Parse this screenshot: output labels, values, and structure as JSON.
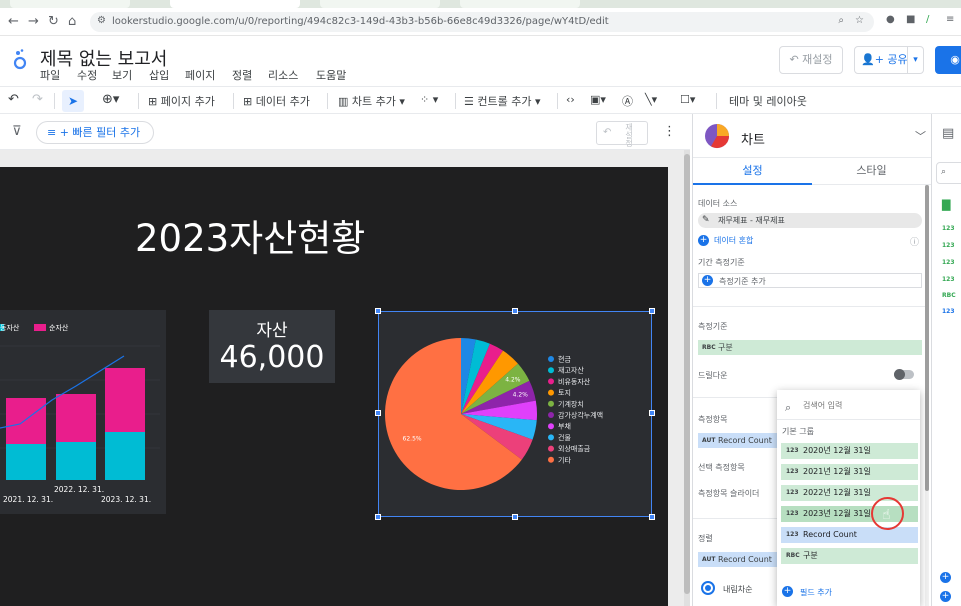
{
  "browser": {
    "url": "lookerstudio.google.com/u/0/reporting/494c82c3-149d-43b3-b56b-66e8c49d3326/page/wY4tD/edit"
  },
  "app": {
    "title": "제목 없는 보고서",
    "menu": [
      "파일",
      "수정",
      "보기",
      "삽입",
      "페이지",
      "정렬",
      "리소스",
      "도움말"
    ],
    "reset_label": "재설정",
    "share_label": "공유"
  },
  "toolbar": {
    "add_page": "페이지 추가",
    "add_data": "데이터 추가",
    "add_chart": "차트 추가",
    "add_control": "컨트롤 추가",
    "theme_layout": "테마 및 레이아웃"
  },
  "filterbar": {
    "quick_filter": "+ 빠른 필터 추가",
    "reset_mini": "재설정"
  },
  "report": {
    "title": "2023자산현황",
    "scorecard": {
      "label": "자산",
      "value": "46,000"
    },
    "bar_chart": {
      "legend": [
        "동자산",
        "순자산"
      ],
      "x_labels": [
        "2021. 12. 31.",
        "2022. 12. 31.",
        "2023. 12. 31."
      ],
      "colors": {
        "bottom": "#00bcd4",
        "top": "#e91e8c",
        "line": "#1a73e8"
      }
    }
  },
  "chart_data": {
    "type": "pie",
    "categories": [
      "현금",
      "재고자산",
      "비유동자산",
      "토지",
      "기계장치",
      "감가상각누계액",
      "부채",
      "건물",
      "외상매출금",
      "기타"
    ],
    "values": [
      3.0,
      3.0,
      3.0,
      4.0,
      4.2,
      4.2,
      4.0,
      4.0,
      4.6,
      62.5
    ],
    "slice_labels": [
      "",
      "",
      "",
      "",
      "4.2%",
      "4.2%",
      "",
      "",
      "",
      "62.5%"
    ],
    "colors": [
      "#1e88e5",
      "#00bcd4",
      "#e91e8c",
      "#ff9800",
      "#7cb342",
      "#8e24aa",
      "#e040fb",
      "#29b6f6",
      "#ec407a",
      "#ff7043"
    ],
    "legend_position": "right"
  },
  "panel": {
    "chart_type": "차트",
    "tab_setup": "설정",
    "tab_style": "스타일",
    "data_source_label": "데이터 소스",
    "data_source": "재무제표 - 재무제표",
    "blend": "데이터 혼합",
    "date_range_label": "기간 측정기준",
    "add_dimension_date": "측정기준 추가",
    "dimension_label": "측정기준",
    "dimension": "구분",
    "drilldown": "드릴다운",
    "metric_label": "측정항목",
    "metric": "Record Count",
    "optional_metrics": "선택 측정항목",
    "metric_slider": "측정항목 슬라이더",
    "sort_label": "정렬",
    "sort_metric": "Record Count",
    "sort_desc": "내림차순"
  },
  "dropdown": {
    "search_placeholder": "검색어 입력",
    "group": "기본 그룹",
    "items": [
      {
        "tag": "123",
        "label": "2020년 12월 31일"
      },
      {
        "tag": "123",
        "label": "2021년 12월 31일"
      },
      {
        "tag": "123",
        "label": "2022년 12월 31일"
      },
      {
        "tag": "123",
        "label": "2023년 12월 31일"
      },
      {
        "tag": "123",
        "label": "Record Count"
      },
      {
        "tag": "RBC",
        "label": "구분"
      }
    ],
    "add_field": "필드 추가"
  },
  "far_panel": {
    "tags": [
      "123",
      "123",
      "123",
      "123",
      "RBC",
      "123"
    ]
  }
}
